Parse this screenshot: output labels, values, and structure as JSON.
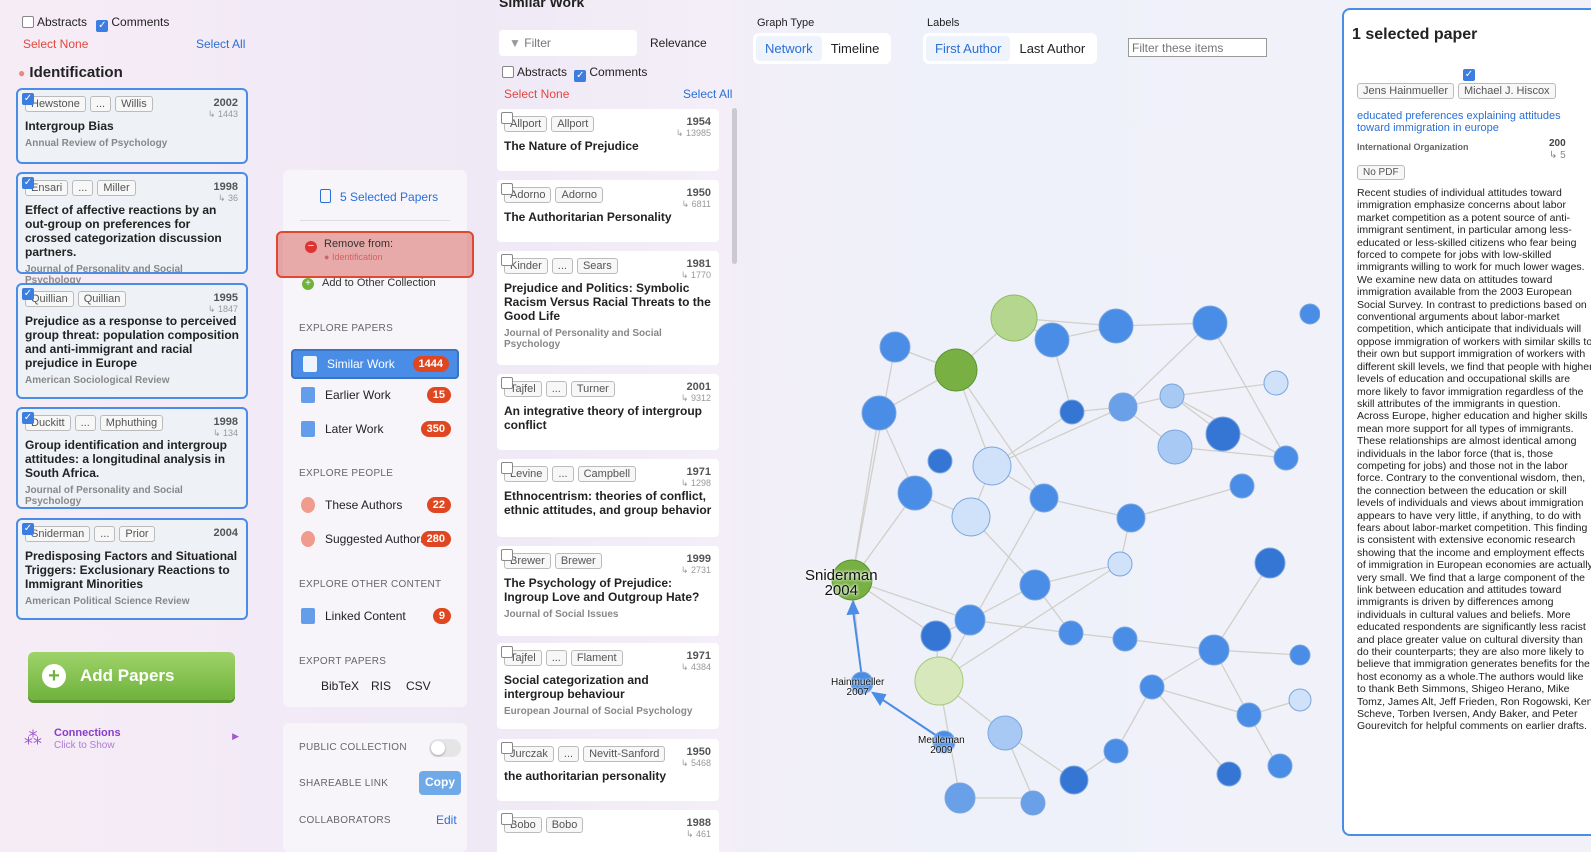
{
  "left": {
    "abstracts": "Abstracts",
    "comments": "Comments",
    "select_none": "Select None",
    "select_all": "Select All",
    "collection": "Identification",
    "papers": [
      {
        "a1": "Hewstone",
        "a2": "Willis",
        "year": "2002",
        "cites": "↳ 1443",
        "title": "Intergroup Bias",
        "journal": "Annual Review of Psychology"
      },
      {
        "a1": "Ensari",
        "a2": "Miller",
        "year": "1998",
        "cites": "↳ 36",
        "title": "Effect of affective reactions by an out-group on preferences for crossed categorization discussion partners.",
        "journal": "Journal of Personality and Social Psychology"
      },
      {
        "a1": "Quillian",
        "a2": "Quillian",
        "year": "1995",
        "cites": "↳ 1847",
        "title": "Prejudice as a response to perceived group threat: population composition and anti-immigrant and racial prejudice in Europe",
        "journal": "American Sociological Review"
      },
      {
        "a1": "Duckitt",
        "a2": "Mphuthing",
        "year": "1998",
        "cites": "↳ 134",
        "title": "Group identification and intergroup attitudes: a longitudinal analysis in South Africa.",
        "journal": "Journal of Personality and Social Psychology"
      },
      {
        "a1": "Sniderman",
        "a2": "Prior",
        "year": "2004",
        "cites": "",
        "title": "Predisposing Factors and Situational Triggers: Exclusionary Reactions to Immigrant Minorities",
        "journal": "American Political Science Review"
      }
    ],
    "ellipsis": "...",
    "add_papers": "Add Papers",
    "connections": "Connections",
    "connections_sub": "Click to Show"
  },
  "menu": {
    "selected": "5 Selected Papers",
    "remove": "Remove from:",
    "remove_sub": "Identification",
    "add_other": "Add to Other Collection",
    "explore_papers": "EXPLORE PAPERS",
    "similar": "Similar Work",
    "similar_n": "1444",
    "earlier": "Earlier Work",
    "earlier_n": "15",
    "later": "Later Work",
    "later_n": "350",
    "explore_people": "EXPLORE PEOPLE",
    "these_authors": "These Authors",
    "these_n": "22",
    "suggested": "Suggested Authors",
    "suggested_n": "280",
    "explore_other": "EXPLORE OTHER CONTENT",
    "linked": "Linked Content",
    "linked_n": "9",
    "export": "EXPORT PAPERS",
    "bibtex": "BibTeX",
    "ris": "RIS",
    "csv": "CSV",
    "public": "PUBLIC COLLECTION",
    "share": "SHAREABLE LINK",
    "copy": "Copy",
    "collab": "COLLABORATORS",
    "edit": "Edit"
  },
  "middle": {
    "header": "Similar Work",
    "filter": "Filter",
    "relevance": "Relevance",
    "abstracts": "Abstracts",
    "comments": "Comments",
    "select_none": "Select None",
    "select_all": "Select All",
    "papers": [
      {
        "a1": "Allport",
        "a2": "Allport",
        "el": false,
        "year": "1954",
        "cites": "↳ 13985",
        "title": "The Nature of Prejudice",
        "journal": ""
      },
      {
        "a1": "Adorno",
        "a2": "Adorno",
        "el": false,
        "year": "1950",
        "cites": "↳ 6811",
        "title": "The Authoritarian Personality",
        "journal": ""
      },
      {
        "a1": "Kinder",
        "a2": "Sears",
        "el": true,
        "year": "1981",
        "cites": "↳ 1770",
        "title": "Prejudice and Politics: Symbolic Racism Versus Racial Threats to the Good Life",
        "journal": "Journal of Personality and Social Psychology"
      },
      {
        "a1": "Tajfel",
        "a2": "Turner",
        "el": true,
        "year": "2001",
        "cites": "↳ 9312",
        "title": "An integrative theory of intergroup conflict",
        "journal": ""
      },
      {
        "a1": "Levine",
        "a2": "Campbell",
        "el": true,
        "year": "1971",
        "cites": "↳ 1298",
        "title": "Ethnocentrism: theories of conflict, ethnic attitudes, and group behavior",
        "journal": ""
      },
      {
        "a1": "Brewer",
        "a2": "Brewer",
        "el": false,
        "year": "1999",
        "cites": "↳ 2731",
        "title": "The Psychology of Prejudice: Ingroup Love and Outgroup Hate?",
        "journal": "Journal of Social Issues"
      },
      {
        "a1": "Tajfel",
        "a2": "Flament",
        "el": true,
        "year": "1971",
        "cites": "↳ 4384",
        "title": "Social categorization and intergroup behaviour",
        "journal": "European Journal of Social Psychology"
      },
      {
        "a1": "Jurczak",
        "a2": "Nevitt-Sanford",
        "el": true,
        "year": "1950",
        "cites": "↳ 5468",
        "title": "the authoritarian personality",
        "journal": ""
      },
      {
        "a1": "Bobo",
        "a2": "Bobo",
        "el": false,
        "year": "1988",
        "cites": "↳ 461",
        "title": "",
        "journal": ""
      }
    ]
  },
  "graph": {
    "graph_type": "Graph Type",
    "network": "Network",
    "timeline": "Timeline",
    "labels": "Labels",
    "first_author": "First Author",
    "last_author": "Last Author",
    "filter_ph": "Filter these items",
    "sniderman": "Sniderman",
    "sniderman_y": "2004",
    "hain": "Hainmueller",
    "hain_y": "2007",
    "meul": "Meuleman",
    "meul_y": "2009"
  },
  "right": {
    "title": "1 selected paper",
    "author1": "Jens Hainmueller",
    "author2": "Michael J. Hiscox",
    "paper_title": "educated preferences explaining attitudes toward immigration in europe",
    "journal": "International Organization",
    "year": "200",
    "cites": "↳ 5",
    "no_pdf": "No PDF",
    "abstract": "Recent studies of individual attitudes toward immigration emphasize concerns about labor market competition as a potent source of anti-immigrant sentiment, in particular among less-educated or less-skilled citizens who fear being forced to compete for jobs with low-skilled immigrants willing to work for much lower wages. We examine new data on attitudes toward immigration available from the 2003 European Social Survey. In contrast to predictions based on conventional arguments about labor-market competition, which anticipate that individuals will oppose immigration of workers with similar skills to their own but support immigration of workers with different skill levels, we find that people with higher levels of education and occupational skills are more likely to favor immigration regardless of the skill attributes of the immigrants in question. Across Europe, higher education and higher skills mean more support for all types of immigrants. These relationships are almost identical among individuals in the labor force (that is, those competing for jobs) and those not in the labor force. Contrary to the conventional wisdom, then, the connection between the education or skill levels of individuals and views about immigration appears to have very little, if anything, to do with fears about labor-market competition. This finding is consistent with extensive economic research showing that the income and employment effects of immigration in European economies are actually very small. We find that a large component of the link between education and attitudes toward immigrants is driven by differences among individuals in cultural values and beliefs. More educated respondents are significantly less racist and place greater value on cultural diversity than do their counterparts; they are also more likely to believe that immigration generates benefits for the host economy as a whole.The authors would like to thank Beth Simmons, Shigeo Herano, Mike Tomz, James Alt, Jeff Frieden, Ron Rogowski, Ken Scheve, Torben Iversen, Andy Baker, and Peter Gourevitch for helpful comments on earlier drafts."
  },
  "colors": {
    "accent": "#2a6fd6",
    "badge": "#e0461f",
    "green": "#8bc34a",
    "node": "#4a8de6"
  }
}
